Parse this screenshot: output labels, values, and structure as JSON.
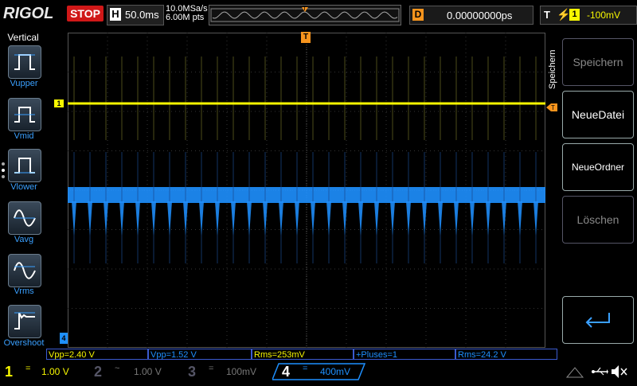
{
  "brand": "RIGOL",
  "run_state": "STOP",
  "timebase": {
    "label": "H",
    "value": "50.0ms"
  },
  "sample": {
    "rate": "10.0MSa/s",
    "points": "6.00M pts"
  },
  "delay": {
    "label": "D",
    "value": "0.00000000ps"
  },
  "trigger": {
    "label": "T",
    "channel": "1",
    "level": "-100mV"
  },
  "markers": {
    "trigger_pos": "T",
    "ch1": "1",
    "ch4": "4"
  },
  "left_menu": {
    "title": "Vertical",
    "items": [
      {
        "label": "Vupper",
        "icon": "vupper-icon"
      },
      {
        "label": "Vmid",
        "icon": "vmid-icon"
      },
      {
        "label": "Vlower",
        "icon": "vlower-icon"
      },
      {
        "label": "Vavg",
        "icon": "vavg-icon"
      },
      {
        "label": "Vrms",
        "icon": "vrms-icon"
      },
      {
        "label": "Overshoot",
        "icon": "overshoot-icon"
      }
    ]
  },
  "right_menu": {
    "title": "Speichern",
    "buttons": [
      "Speichern",
      "NeueDatei",
      "NeueOrdner",
      "Löschen"
    ]
  },
  "measurements": [
    "Vpp=2.40 V",
    "Vpp=1.52 V",
    "Rms=253mV",
    "+Pluses=1",
    "Rms=24.2 V"
  ],
  "channels": [
    {
      "num": "1",
      "coupling": "=",
      "scale": "1.00 V",
      "color": "#f7f700",
      "active": true
    },
    {
      "num": "2",
      "coupling": "~",
      "scale": "1.00 V",
      "color": "#00c8c8",
      "active": false
    },
    {
      "num": "3",
      "coupling": "=",
      "scale": "100mV",
      "color": "#e040e0",
      "active": false
    },
    {
      "num": "4",
      "coupling": "=",
      "scale": "400mV",
      "color": "#1e90ff",
      "active": true
    }
  ],
  "colors": {
    "ch1": "#f7f700",
    "ch4": "#1e90ff",
    "trigger": "#f7941d",
    "stop": "#d01818"
  }
}
